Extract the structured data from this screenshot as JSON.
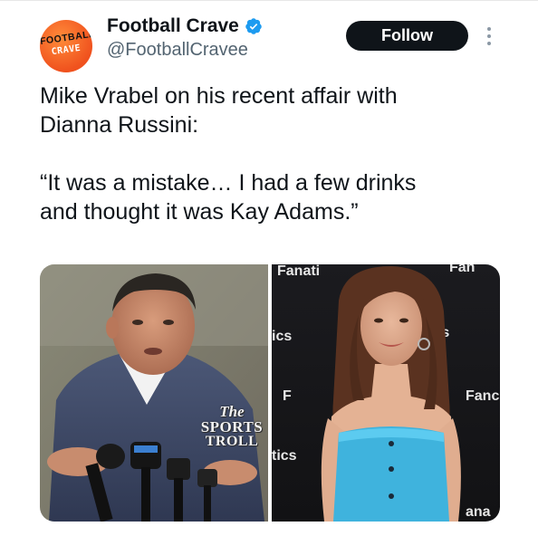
{
  "tweet": {
    "author": {
      "display_name": "Football Crave",
      "handle": "@FootballCravee",
      "verified": true,
      "avatar_text_1": "FOOTBALL",
      "avatar_text_2": "CRAVE"
    },
    "follow_label": "Follow",
    "text": "Mike Vrabel on his recent affair with\nDianna Russini:\n\n“It was a mistake… I had a few drinks\nand thought it was Kay Adams.”",
    "media": {
      "left_image_watermark": [
        "The",
        "SPORTS",
        "TROLL"
      ],
      "right_image_backdrop_text": [
        "Fanati",
        "Fan",
        "ics",
        "ics",
        "F",
        "Fanc",
        "tics",
        "ana"
      ]
    }
  },
  "colors": {
    "follow_button_bg": "#0f1419",
    "verified_blue": "#1d9bf0",
    "handle_gray": "#536471",
    "dress_blue": "#3fb3dd"
  },
  "icons": [
    "verified-badge-icon",
    "more-options-icon"
  ]
}
